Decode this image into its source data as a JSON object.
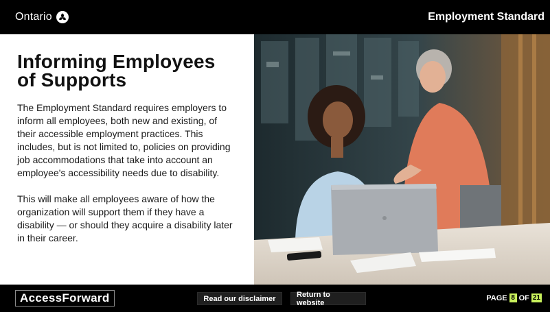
{
  "header": {
    "brand": "Ontario",
    "title": "Employment Standard"
  },
  "main": {
    "heading": "Informing Employees of Supports",
    "paragraphs": [
      "The Employment Standard requires employers to inform all employees, both new and existing, of their accessible employment practices. This includes, but is not limited to, policies on providing job accommodations that take into account an employee's accessibility needs due to disability.",
      "This will make all employees aware of how the organization will support them if they have a disability — or should they acquire a disability later in their career."
    ]
  },
  "footer": {
    "logo": "AccessForward",
    "disclaimer_label": "Read our disclaimer",
    "return_label": "Return to website",
    "page_label": "PAGE",
    "page_current": "8",
    "of_label": "OF",
    "page_total": "21"
  },
  "colors": {
    "header_bg": "#000000",
    "footer_bg": "#000000",
    "page_accent": "#c8f05c"
  }
}
